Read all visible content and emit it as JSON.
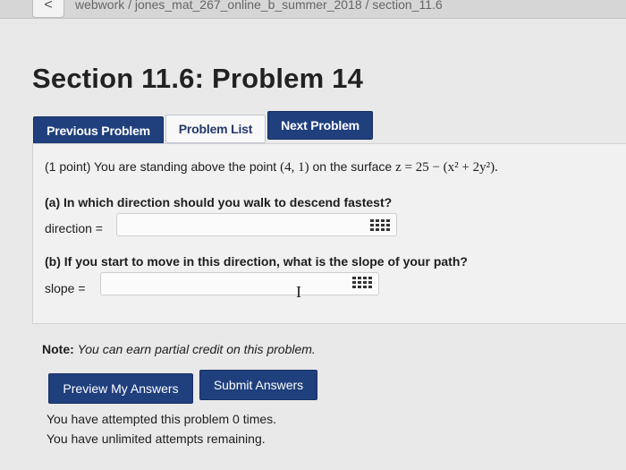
{
  "browser": {
    "back_glyph": "<",
    "breadcrumb": "webwork / jones_mat_267_online_b_summer_2018 / section_11.6"
  },
  "page": {
    "title": "Section 11.6: Problem 14"
  },
  "nav": {
    "previous": "Previous Problem",
    "list": "Problem List",
    "next": "Next Problem"
  },
  "problem": {
    "intro_prefix": "(1 point) You are standing above the point",
    "point": "(4, 1)",
    "intro_middle": "on the surface",
    "equation": "z = 25 − (x² + 2y²).",
    "part_a_question": "(a) In which direction should you walk to descend fastest?",
    "part_a_label": "direction =",
    "part_a_value": "",
    "part_b_question": "(b) If you start to move in this direction, what is the slope of your path?",
    "part_b_label": "slope =",
    "part_b_value": ""
  },
  "note": {
    "label": "Note:",
    "text": "You can earn partial credit on this problem."
  },
  "actions": {
    "preview": "Preview My Answers",
    "submit": "Submit Answers"
  },
  "status": {
    "attempted": "You have attempted this problem 0 times.",
    "remaining": "You have unlimited attempts remaining."
  }
}
